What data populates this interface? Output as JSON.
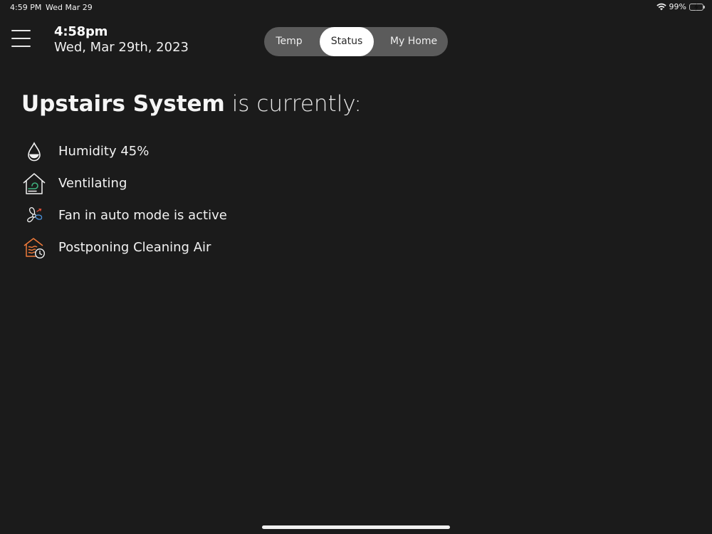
{
  "status_bar": {
    "time": "4:59 PM",
    "date": "Wed Mar 29",
    "battery_percent": "99%",
    "battery_level": 0.99,
    "charging": true,
    "battery_color": "#34c759"
  },
  "header": {
    "menu_icon": "hamburger-menu-icon",
    "time": "4:58pm",
    "date": "Wed, Mar 29th, 2023"
  },
  "tabs": [
    {
      "label": "Temp",
      "selected": false
    },
    {
      "label": "Status",
      "selected": true
    },
    {
      "label": "My Home",
      "selected": false
    }
  ],
  "main": {
    "system_name": "Upstairs System",
    "heading_suffix": " is currently:",
    "status_items": [
      {
        "icon": "humidity-drop-icon",
        "text": "Humidity 45%"
      },
      {
        "icon": "ventilation-house-icon",
        "text": "Ventilating"
      },
      {
        "icon": "fan-icon",
        "text": "Fan in auto mode is active"
      },
      {
        "icon": "cleaning-air-postponed-icon",
        "text": "Postponing Cleaning Air"
      }
    ]
  },
  "colors": {
    "background": "#1b1b1b",
    "segment_background": "#5b5b5b",
    "segment_selected": "#ffffff",
    "accent_green": "#3fb27f",
    "accent_orange": "#f07a3a",
    "accent_blue": "#4a90d9",
    "accent_red": "#e0503a"
  }
}
